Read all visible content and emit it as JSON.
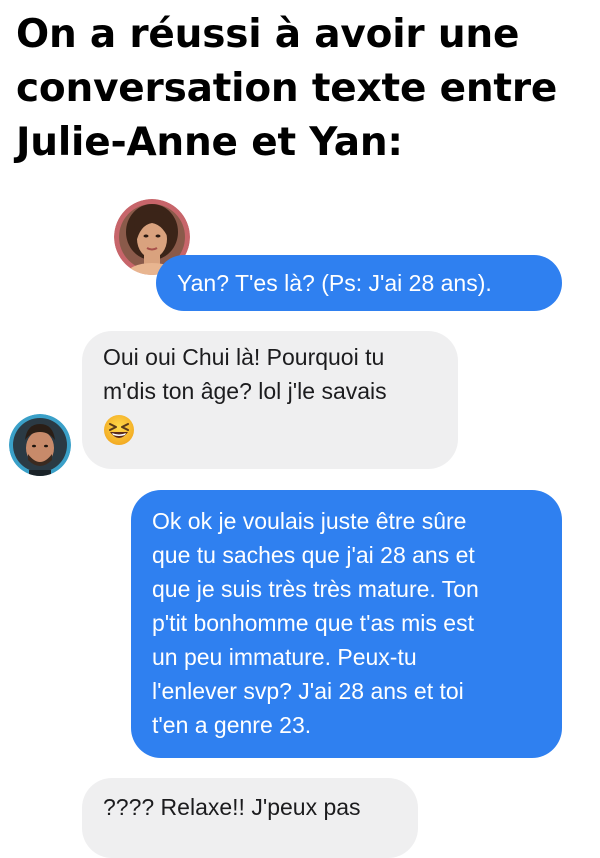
{
  "headline": {
    "lines": [
      "On a réussi à avoir une",
      "conversation texte entre",
      "Julie-Anne et Yan:"
    ]
  },
  "messages": [
    {
      "sender": "Julie-Anne",
      "direction": "outgoing",
      "lines": [
        "Yan? T'es là? (Ps: J'ai 28 ans)."
      ]
    },
    {
      "sender": "Yan",
      "direction": "incoming",
      "lines": [
        "Oui oui Chui là! Pourquoi tu",
        "m'dis ton âge? lol j'le savais"
      ],
      "emoji": "grinning-squinting-face-emoji"
    },
    {
      "sender": "Julie-Anne",
      "direction": "outgoing",
      "lines": [
        "Ok ok je voulais juste être sûre",
        "que tu saches que j'ai 28 ans et",
        "que je suis très très mature. Ton",
        "p'tit bonhomme que t'as mis est",
        "un peu immature. Peux-tu",
        "l'enlever svp? J'ai 28 ans et toi",
        "t'en a genre 23."
      ]
    },
    {
      "sender": "Yan",
      "direction": "incoming",
      "lines": [
        "???? Relaxe!! J'peux pas"
      ]
    }
  ],
  "colors": {
    "outgoing_bubble": "#2f80f0",
    "incoming_bubble": "#efeff0",
    "outgoing_text": "#ffffff",
    "incoming_text": "#1c1c1e"
  }
}
